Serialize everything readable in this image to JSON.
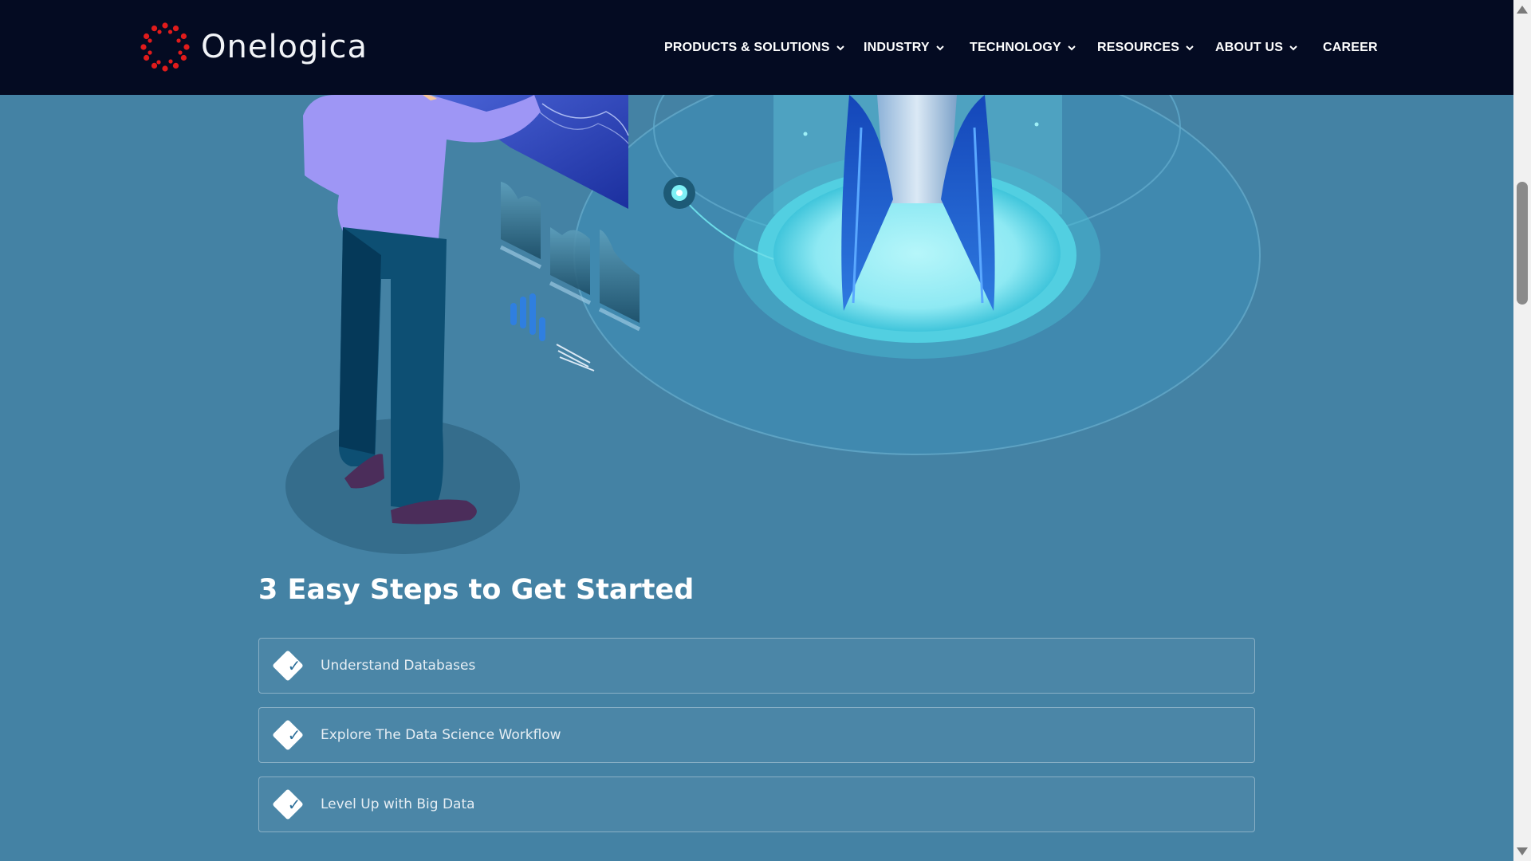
{
  "brand": {
    "name": "Onelogica",
    "logo_color": "#e01b1b"
  },
  "nav": {
    "items": [
      {
        "label": "PRODUCTS & SOLUTIONS",
        "dropdown": true
      },
      {
        "label": "INDUSTRY",
        "dropdown": true
      },
      {
        "label": "TECHNOLOGY",
        "dropdown": true
      },
      {
        "label": "RESOURCES",
        "dropdown": true
      },
      {
        "label": "ABOUT US",
        "dropdown": true
      },
      {
        "label": "CAREER",
        "dropdown": false
      }
    ]
  },
  "steps": {
    "title": "3 Easy Steps to Get Started",
    "items": [
      {
        "label": "Understand Databases",
        "icon": "check-icon"
      },
      {
        "label": "Explore The Data Science Workflow",
        "icon": "check-icon"
      },
      {
        "label": "Level Up with Big Data",
        "icon": "check-icon"
      }
    ]
  },
  "colors": {
    "header_bg": "#040b22",
    "page_bg": "#4482a4",
    "accent_cyan": "#9eeff6"
  }
}
